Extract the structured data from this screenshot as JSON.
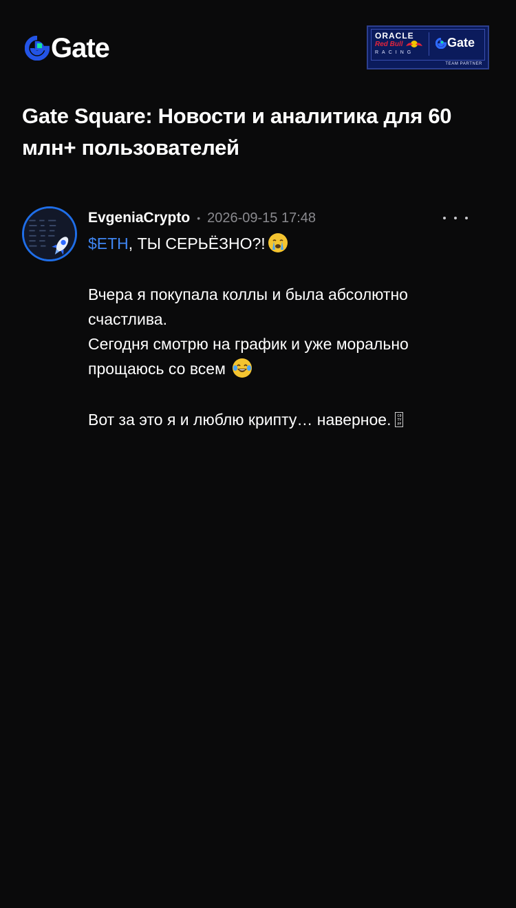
{
  "brand": {
    "name": "Gate",
    "accent": "#2354e6",
    "accent_green": "#17e6a1"
  },
  "partner_badge": {
    "line1": "ORACLE",
    "line2": "Red Bull",
    "line3": "RACING",
    "gate": "Gate",
    "footer": "TEAM PARTNER"
  },
  "title": "Gate Square: Новости и аналитика для 60 млн+ пользователей",
  "post": {
    "author": "EvgeniaCrypto",
    "separator": "•",
    "timestamp": "2026-09-15 17:48",
    "more_icon": "more-horizontal-icon",
    "ticker": "$ETH",
    "line1_rest": ", ТЫ СЕРЬЁЗНО?!",
    "line1_emoji": "crying-face-icon",
    "para2_line1": "Вчера я покупала коллы и была абсолютно счастлива.",
    "para2_line2": "Сегодня смотрю на график и уже морально прощаюсь со всем",
    "para2_emoji": "tears-of-joy-icon",
    "para3": "Вот за это я и люблю крипту… наверное.",
    "para3_glyph": "missing-glyph-box",
    "para3_glyph_text": [
      "C0",
      "TY",
      "PF"
    ]
  },
  "colors": {
    "background": "#0a0a0b",
    "text": "#ffffff",
    "muted": "#8a8a8f",
    "ticker": "#3f86f3",
    "avatar_ring": "#1f6ee8"
  }
}
